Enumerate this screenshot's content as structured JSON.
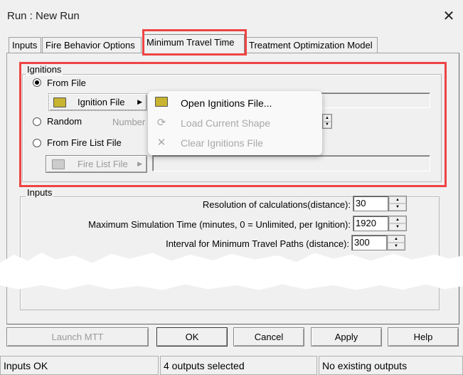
{
  "window": {
    "title": "Run : New Run",
    "close_icon": "close-icon"
  },
  "tabs": [
    {
      "label": "Inputs",
      "active": false
    },
    {
      "label": "Fire Behavior Options",
      "active": false
    },
    {
      "label": "Minimum Travel Time",
      "active": true
    },
    {
      "label": "Treatment Optimization Model",
      "active": false
    }
  ],
  "ignitions": {
    "group_label": "Ignitions",
    "from_file": {
      "label": "From File",
      "selected": true
    },
    "ignition_file_button": "Ignition File",
    "ignition_file_value": "",
    "random": {
      "label": "Random",
      "selected": false
    },
    "number_label": "Number",
    "from_fire_list": {
      "label": "From Fire List File",
      "selected": false
    },
    "fire_list_button": "Fire List File",
    "fire_list_value": ""
  },
  "context_menu": {
    "items": [
      {
        "label": "Open Ignitions File...",
        "icon": "folder-open-icon",
        "enabled": true
      },
      {
        "label": "Load Current Shape",
        "icon": "load-shape-icon",
        "enabled": false
      },
      {
        "label": "Clear Ignitions File",
        "icon": "clear-x-icon",
        "enabled": false
      }
    ]
  },
  "inputs": {
    "group_label": "Inputs",
    "rows": [
      {
        "label": "Resolution of calculations(distance):",
        "value": "30"
      },
      {
        "label": "Maximum Simulation Time (minutes, 0 = Unlimited, per Ignition):",
        "value": "1920"
      },
      {
        "label": "Interval for Minimum Travel Paths (distance):",
        "value": "300"
      }
    ]
  },
  "buttons": {
    "launch": "Launch MTT",
    "ok": "OK",
    "cancel": "Cancel",
    "apply": "Apply",
    "help": "Help"
  },
  "status": [
    "Inputs OK",
    "4 outputs selected",
    "No existing outputs"
  ],
  "colors": {
    "highlight": "#ee4444",
    "background": "#f0f0f0"
  }
}
